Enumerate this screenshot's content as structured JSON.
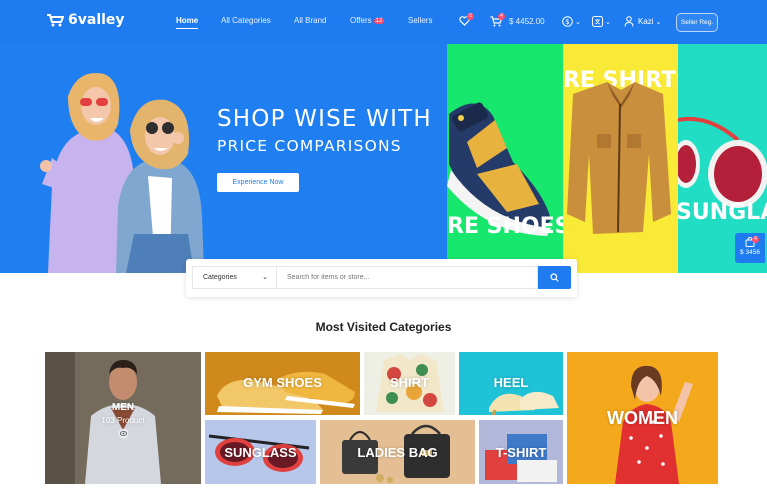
{
  "brand": {
    "name": "6valley"
  },
  "nav": {
    "items": [
      {
        "label": "Home"
      },
      {
        "label": "All Categories"
      },
      {
        "label": "All Brand"
      },
      {
        "label": "Offers",
        "badge": "12"
      },
      {
        "label": "Sellers"
      }
    ]
  },
  "header_actions": {
    "wishlist_count": "0",
    "cart_count": "4",
    "cart_total": "$ 4452.00",
    "user_name": "Kazi",
    "seller_button": "Seller Reg."
  },
  "hero": {
    "title": "SHOP WISE WITH",
    "subtitle": "PRICE COMPARISONS",
    "button": "Experience Now",
    "panels": [
      {
        "text": "RE SHOES",
        "color": "#17e86d"
      },
      {
        "text": "RE SHIRTS",
        "color": "#f9ea37"
      },
      {
        "text": "SUNGLA",
        "color": "#20ddc4"
      }
    ]
  },
  "floating_cart": {
    "count": "4",
    "total": "$ 3456"
  },
  "search": {
    "category_label": "Categories",
    "placeholder": "Search for items or store..."
  },
  "section": {
    "title": "Most Visited Categories"
  },
  "categories": [
    {
      "label": "MEN",
      "sublabel": "103 Product"
    },
    {
      "label": "GYM SHOES"
    },
    {
      "label": "SHIRT"
    },
    {
      "label": "HEEL"
    },
    {
      "label": "WOMEN"
    },
    {
      "label": "SUNGLASS"
    },
    {
      "label": "LADIES BAG"
    },
    {
      "label": "T-SHIRT"
    }
  ],
  "colors": {
    "primary": "#1e7cf0",
    "badge": "#ff4d6d"
  }
}
